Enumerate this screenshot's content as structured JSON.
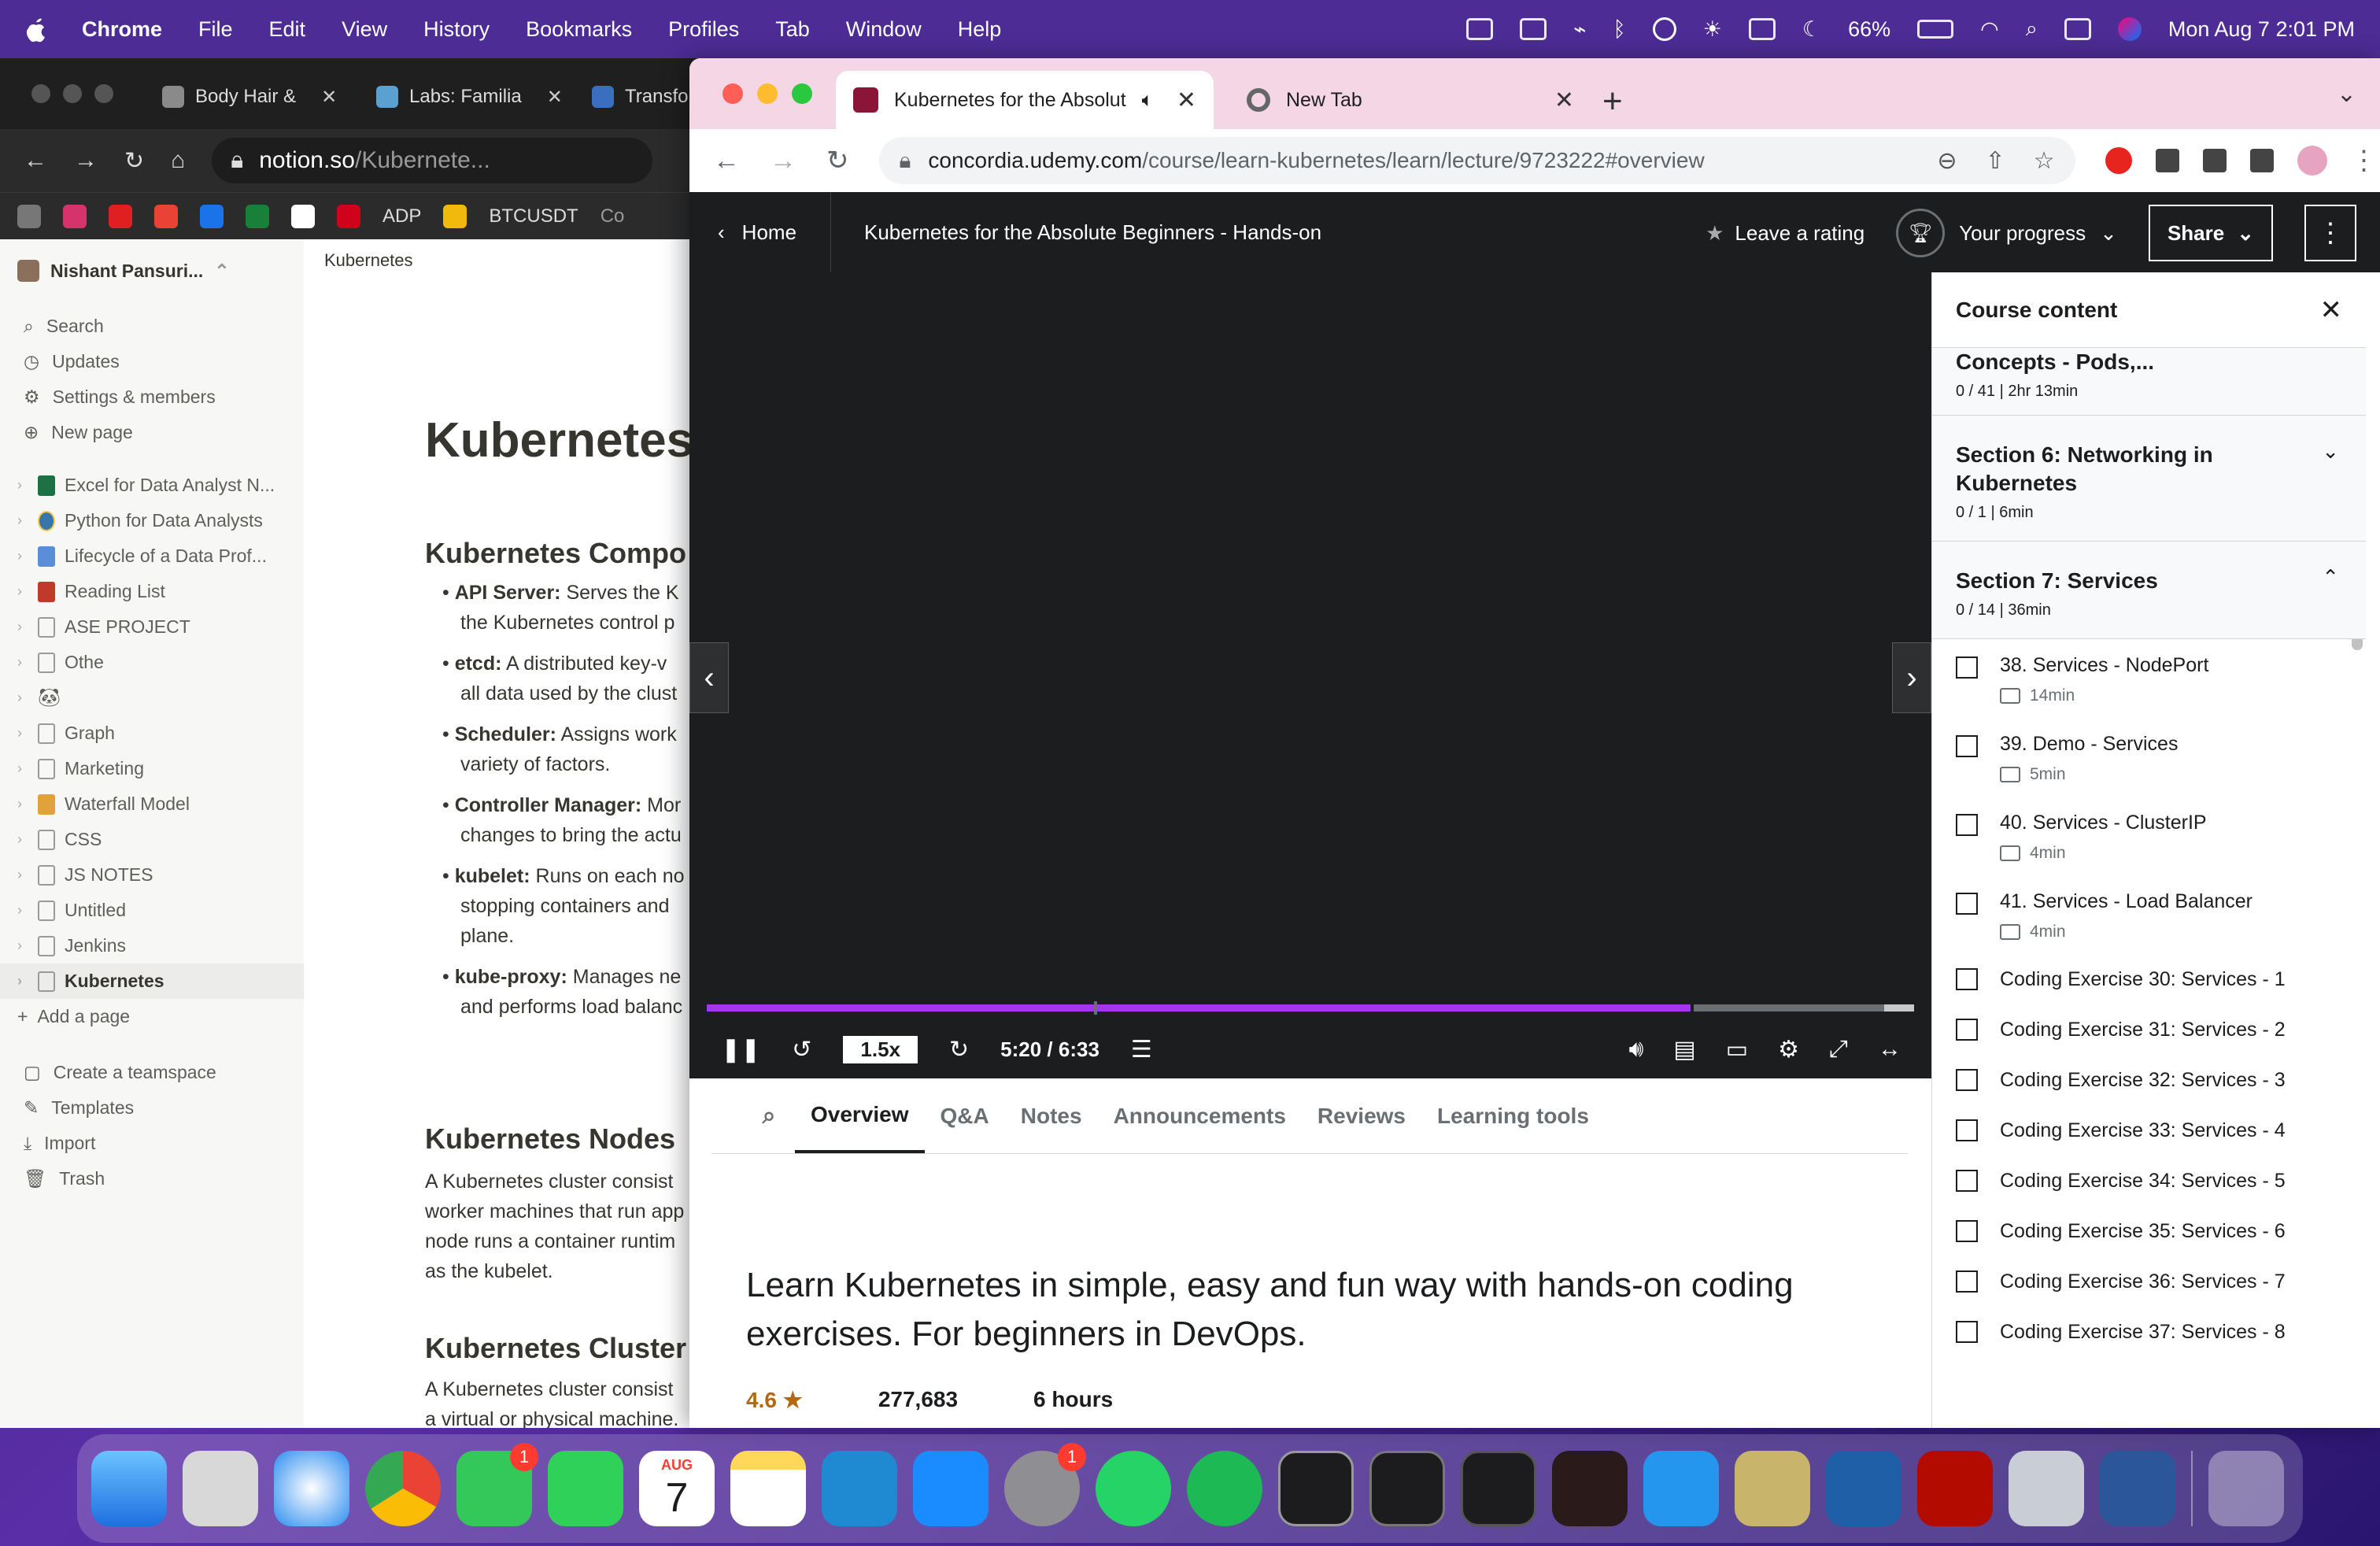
{
  "menubar": {
    "app_name": "Chrome",
    "items": [
      "File",
      "Edit",
      "View",
      "History",
      "Bookmarks",
      "Profiles",
      "Tab",
      "Window",
      "Help"
    ],
    "battery": "66%",
    "clock": "Mon Aug 7  2:01 PM"
  },
  "notion_window": {
    "tabs": [
      "Body Hair &",
      "Labs: Familia",
      "Transfo"
    ],
    "url_host": "notion.so",
    "url_path": "/Kubernete...",
    "bookmarks": [
      "ADP",
      "BTCUSDT",
      "Co"
    ],
    "workspace": "Nishant Pansuri...",
    "nav": [
      "Search",
      "Updates",
      "Settings & members",
      "New page"
    ],
    "pages": [
      "Excel for Data Analyst N...",
      "Python for Data Analysts",
      "Lifecycle of a Data Prof...",
      "Reading List",
      "ASE PROJECT",
      "Othe",
      "",
      "Graph",
      "Marketing",
      "Waterfall Model",
      "CSS",
      "JS NOTES",
      "Untitled",
      "Jenkins",
      "Kubernetes"
    ],
    "add_page": "Add a page",
    "footer": [
      "Create a teamspace",
      "Templates",
      "Import",
      "Trash"
    ],
    "breadcrumb": "Kubernetes",
    "h1": "Kubernetes",
    "h2_components": "Kubernetes Compo",
    "components": [
      {
        "term": "API Server:",
        "line1": " Serves the K",
        "line2": "the Kubernetes control p"
      },
      {
        "term": "etcd:",
        "line1": " A distributed key-v",
        "line2": "all data used by the clust"
      },
      {
        "term": "Scheduler:",
        "line1": " Assigns work",
        "line2": "variety of factors."
      },
      {
        "term": "Controller Manager:",
        "line1": " Mor",
        "line2": "changes to bring the actu"
      },
      {
        "term": "kubelet:",
        "line1": " Runs on each no",
        "line2": "stopping containers and",
        "line3": "plane."
      },
      {
        "term": "kube-proxy:",
        "line1": " Manages ne",
        "line2": "and performs load balanc"
      }
    ],
    "h2_nodes": "Kubernetes Nodes",
    "nodes_text": [
      "A Kubernetes cluster consist",
      "worker machines that run app",
      "node runs a container runtim",
      "as the kubelet."
    ],
    "h2_cluster": "Kubernetes Cluster",
    "cluster_text": [
      "A Kubernetes cluster consist",
      "a virtual or physical machine."
    ]
  },
  "udemy_window": {
    "tab_active": "Kubernetes for the Absolut",
    "tab_new": "New Tab",
    "url_host": "concordia.udemy.com",
    "url_path": "/course/learn-kubernetes/learn/lecture/9723222#overview",
    "header": {
      "home": "Home",
      "course_title": "Kubernetes for the Absolute Beginners - Hands-on",
      "leave_rating": "Leave a rating",
      "your_progress": "Your progress",
      "share": "Share"
    },
    "player": {
      "speed": "1.5x",
      "time": "5:20 / 6:33",
      "progress": 0.815
    },
    "tabs": [
      "Overview",
      "Q&A",
      "Notes",
      "Announcements",
      "Reviews",
      "Learning tools"
    ],
    "description": "Learn Kubernetes in simple, easy and fun way with hands-on coding exercises. For beginners in DevOps.",
    "stats": {
      "rating": "4.6",
      "students": "277,683",
      "duration": "6 hours"
    },
    "sidebar": {
      "title": "Course content",
      "sections": [
        {
          "title": "Concepts - Pods,...",
          "meta": "0 / 41 | 2hr 13min"
        },
        {
          "title": "Section 6: Networking in Kubernetes",
          "meta": "0 / 1 | 6min"
        },
        {
          "title": "Section 7: Services",
          "meta": "0 / 14 | 36min"
        }
      ],
      "lectures": [
        {
          "title": "38. Services - NodePort",
          "duration": "14min"
        },
        {
          "title": "39. Demo - Services",
          "duration": "5min"
        },
        {
          "title": "40. Services - ClusterIP",
          "duration": "4min"
        },
        {
          "title": "41. Services - Load Balancer",
          "duration": "4min"
        }
      ],
      "exercises": [
        "Coding Exercise 30: Services - 1",
        "Coding Exercise 31: Services - 2",
        "Coding Exercise 32: Services - 3",
        "Coding Exercise 33: Services - 4",
        "Coding Exercise 34: Services - 5",
        "Coding Exercise 35: Services - 6",
        "Coding Exercise 36: Services - 7",
        "Coding Exercise 37: Services - 8"
      ]
    }
  },
  "dock": {
    "calendar_month": "AUG",
    "calendar_day": "7",
    "messages_badge": "1",
    "settings_badge": "1"
  },
  "colors": {
    "udemy_purple": "#a435f0",
    "udemy_dark": "#1c1d1f",
    "tab_bar_pink": "#f4d6e4",
    "rating_orange": "#b4690e"
  }
}
